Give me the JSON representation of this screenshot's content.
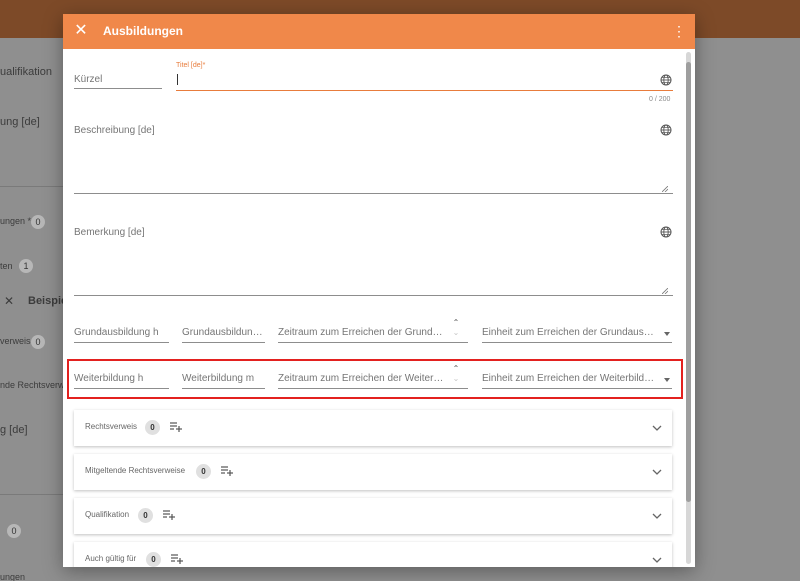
{
  "background": {
    "texts": [
      "ualifikation",
      "ung [de]",
      "ungen *",
      "ten",
      "Beispiel",
      "verweis",
      "nde Rechtsverw",
      "g [de]",
      "ungen"
    ],
    "badges": [
      "0",
      "1",
      "0",
      "0"
    ]
  },
  "dialog": {
    "title": "Ausbildungen",
    "close_icon": "close-icon",
    "menu_icon": "more-vert-icon",
    "fields": {
      "kuerzel": {
        "placeholder": "Kürzel"
      },
      "titel": {
        "label": "Titel [de]*",
        "counter": "0 / 200"
      },
      "beschreibung": {
        "label": "Beschreibung [de]"
      },
      "bemerkung": {
        "label": "Bemerkung [de]"
      }
    },
    "grundausbildung": {
      "hours": "Grundausbildung h",
      "minutes": "Grundausbildung m",
      "period": "Zeitraum zum Erreichen der Grundaus...",
      "unit": "Einheit zum Erreichen der Grundausbild..."
    },
    "weiterbildung": {
      "hours": "Weiterbildung h",
      "minutes": "Weiterbildung m",
      "period": "Zeitraum zum Erreichen der Weiterbil...",
      "unit": "Einheit zum Erreichen der Weiterbildung"
    },
    "panels": [
      {
        "label": "Rechtsverweis",
        "count": "0"
      },
      {
        "label": "Mitgeltende Rechtsverweise",
        "count": "0"
      },
      {
        "label": "Qualifikation",
        "count": "0"
      },
      {
        "label": "Auch gültig für",
        "count": "0"
      }
    ],
    "colors": {
      "header": "#f0884a",
      "accent": "#e87c3c",
      "highlight": "#e3211f"
    }
  }
}
